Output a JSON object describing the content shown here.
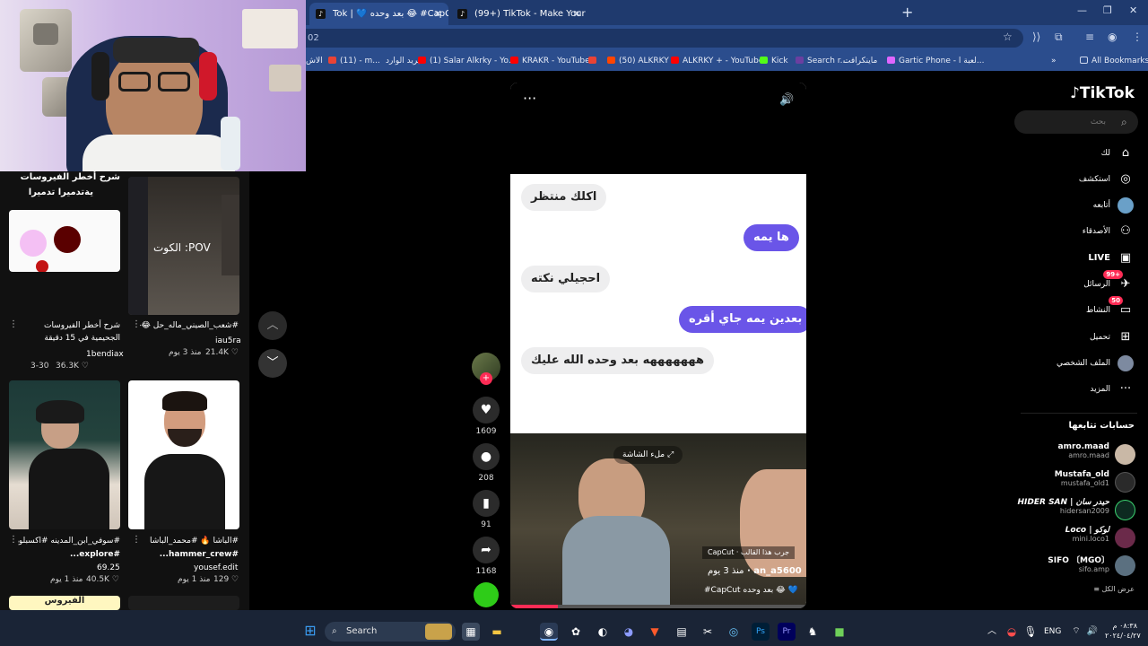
{
  "browser": {
    "tabs": [
      {
        "label": "Tok | 💙 بعد وحده 😂 #CapCut",
        "active": true
      },
      {
        "label": "(99+) TikTok - Make Your Day",
        "active": false
      }
    ],
    "address": "02",
    "bookmarks": [
      {
        "label": "الاش",
        "color": "#555555"
      },
      {
        "label": "(11) - m...",
        "color": "#ea4335"
      },
      {
        "label": "البريد الوارد",
        "color": "#ea4335"
      },
      {
        "label": "(1) Salar Alkrky - Yo...",
        "color": "#ff0000"
      },
      {
        "label": "KRAKR - YouTube",
        "color": "#ff0000"
      },
      {
        "label": "(50) ALKRKY",
        "color": "#ff4500"
      },
      {
        "label": "ALKRKY + - YouTube",
        "color": "#ff0000"
      },
      {
        "label": "Kick",
        "color": "#53fc18"
      },
      {
        "label": "Search r...",
        "color": "#1e1e1e"
      },
      {
        "label": "ماينكرافت",
        "color": "#c8c8c8"
      },
      {
        "label": "Gartic Phone - لعبة ا...",
        "color": "#e066ff"
      }
    ],
    "all_bookmarks": "All Bookmarks"
  },
  "feed": {
    "top_card_title_line1": "شرح أخطر الفيروسات",
    "top_card_title_line2": "يةتدميرا تدميرا",
    "pov_text": "POV: الكوت",
    "cards": [
      {
        "title": "شرح أخطر الفيروسات الجحيمية في 15 دقيقة",
        "user": "1bendiax",
        "views": "36.3K",
        "date": "3-30"
      },
      {
        "title": "#شعب_الصيني_ماله_حل 😂😂",
        "user": "iau5ra",
        "views": "21.4K",
        "date": "منذ 3 يوم"
      },
      {
        "title": "#سوفي_ابن_المدينه #اكسبلور",
        "tag": "#explore...",
        "user": "69.25",
        "views": "40.5K",
        "date": "منذ 1 يوم"
      },
      {
        "title": "#الباشا 🔥 #محمد_الباشا",
        "tag": "#hammer_crew...",
        "user": "yousef.edit",
        "views": "129",
        "date": "منذ 1 يوم"
      }
    ],
    "bottom_partial": "الفيروس"
  },
  "video": {
    "messages": [
      {
        "text": "اكلك منتظر",
        "side": "l"
      },
      {
        "text": "ها يمه",
        "side": "r"
      },
      {
        "text": "احجيلي نكته",
        "side": "l"
      },
      {
        "text": "بعدين يمه جاي أقره",
        "side": "r"
      },
      {
        "text": "هههههههه بعد وحده الله عليك",
        "side": "l"
      }
    ],
    "fill_screen": "ملء الشاشة",
    "template": "CapCut · جرب هذا القالب",
    "author": "an_a5600",
    "time": "منذ 3 يوم",
    "caption": "#CapCut بعد وحده 😂 💙"
  },
  "actions": {
    "likes": "1609",
    "comments": "208",
    "saves": "91",
    "shares": "1168"
  },
  "sidebar": {
    "logo": "TikTok",
    "search_placeholder": "بحث",
    "items": [
      {
        "label": "لك",
        "icon": "⌂"
      },
      {
        "label": "استكشف",
        "icon": "◎"
      },
      {
        "label": "أتابعه",
        "icon": "●"
      },
      {
        "label": "الأصدقاء",
        "icon": "⚇"
      },
      {
        "label": "LIVE",
        "icon": "▣"
      },
      {
        "label": "الرسائل",
        "icon": "✈",
        "badge": "+99"
      },
      {
        "label": "النشاط",
        "icon": "▭",
        "badge": "50"
      },
      {
        "label": "تحميل",
        "icon": "⊞"
      },
      {
        "label": "الملف الشخصي",
        "icon": "●"
      },
      {
        "label": "المزيد",
        "icon": "···"
      }
    ],
    "following_title": "حسابات تتابعها",
    "following": [
      {
        "name": "amro.maad",
        "user": "amro.maad"
      },
      {
        "name": "Mustafa_old",
        "user": "mustafa_old1"
      },
      {
        "name": "HIDER SAN | حيدر سان",
        "user": "hidersan2009"
      },
      {
        "name": "Loco | لوكو",
        "user": "mini.loco1"
      },
      {
        "name": "SIFO 〔MGO〕",
        "user": "sifo.amp"
      }
    ],
    "see_all": "عرض الكل"
  },
  "taskbar": {
    "search": "Search",
    "lang": "ENG",
    "time": "٠٨:٣٨ م",
    "date": "٢٠٢٤/٠٤/٢٧"
  }
}
